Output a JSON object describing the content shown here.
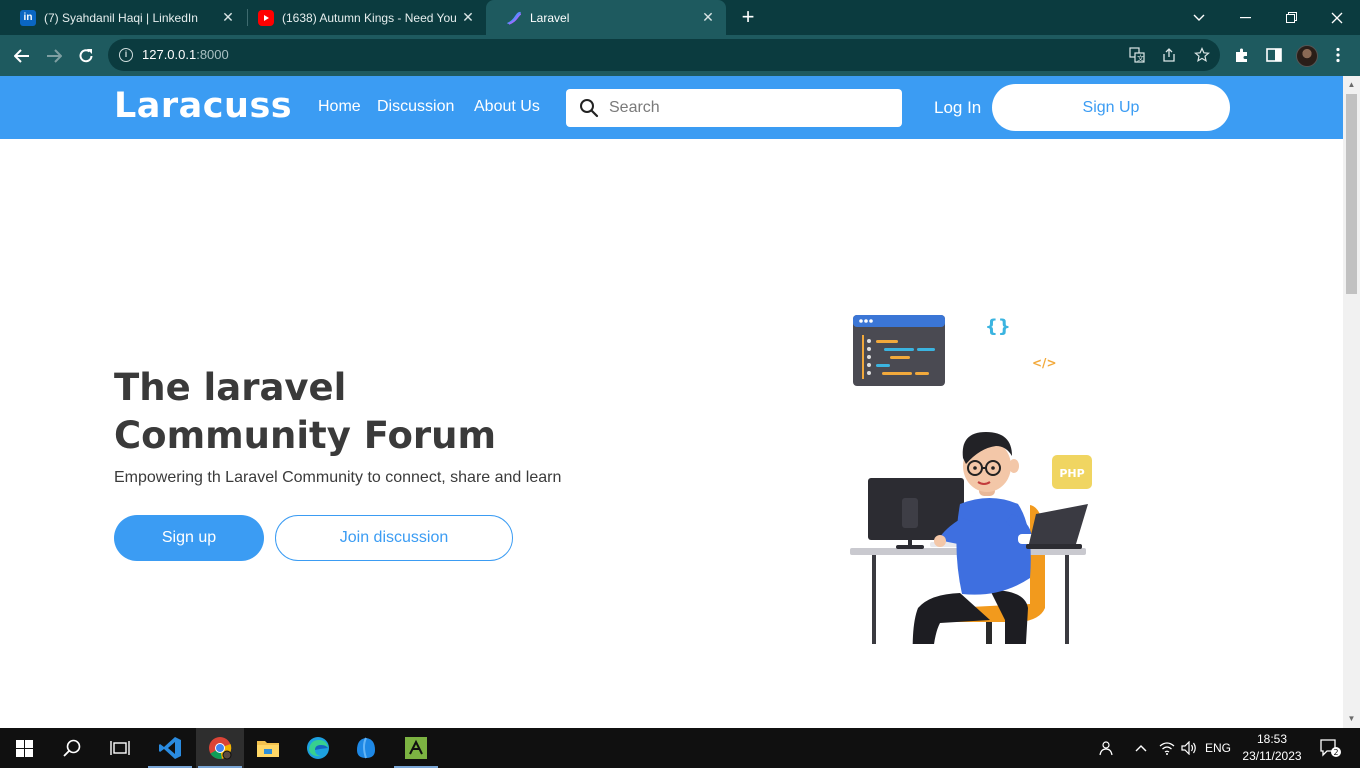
{
  "browser": {
    "tabs": [
      {
        "title": "(7) Syahdanil Haqi | LinkedIn",
        "icon": "linkedin-icon"
      },
      {
        "title": "(1638) Autumn Kings - Need You",
        "icon": "youtube-icon"
      },
      {
        "title": "Laravel",
        "icon": "laravel-icon",
        "active": true
      }
    ],
    "url_host": "127.0.0.1",
    "url_port": ":8000"
  },
  "site": {
    "logo": "Laracuss",
    "nav": {
      "home": "Home",
      "discussion": "Discussion",
      "about": "About Us"
    },
    "search_placeholder": "Search",
    "login": "Log In",
    "signup": "Sign Up",
    "brand_color": "#3b9cf3"
  },
  "hero": {
    "title_line1": "The laravel",
    "title_line2": "Community Forum",
    "subtitle": "Empowering th Laravel Community to connect, share and learn",
    "primary_button": "Sign up",
    "secondary_button": "Join discussion",
    "illustration": {
      "badge_php": "PHP",
      "badge_braces": "{}",
      "badge_tag": "</>"
    }
  },
  "taskbar": {
    "apps": [
      "start-icon",
      "search-icon",
      "task-view-icon",
      "vscode-icon",
      "chrome-icon",
      "file-explorer-icon",
      "edge-icon",
      "app-icon",
      "xampp-icon"
    ],
    "language": "ENG",
    "time": "18:53",
    "date": "23/11/2023",
    "notifications": "2"
  }
}
